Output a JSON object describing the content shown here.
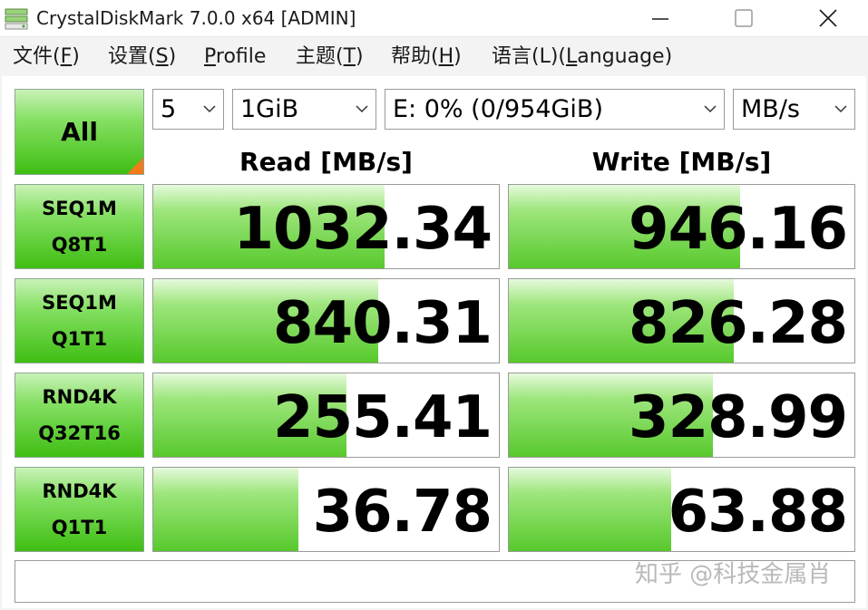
{
  "window": {
    "title": "CrystalDiskMark 7.0.0 x64 [ADMIN]"
  },
  "menu": [
    {
      "label": "文件(F)",
      "mnemonic": "F",
      "pre": "文件(",
      "post": ")"
    },
    {
      "label": "设置(S)",
      "mnemonic": "S",
      "pre": "设置(",
      "post": ")"
    },
    {
      "label": "Profile",
      "mnemonic": "P",
      "pre": "",
      "post": "rofile"
    },
    {
      "label": "主题(T)",
      "mnemonic": "T",
      "pre": "主题(",
      "post": ")"
    },
    {
      "label": "帮助(H)",
      "mnemonic": "H",
      "pre": "帮助(",
      "post": ")"
    },
    {
      "label": "语言(L)(Language)",
      "mnemonic": "L",
      "pre": "语言(L)(",
      "post": "anguage)"
    }
  ],
  "controls": {
    "all_label": "All",
    "count": "5",
    "size": "1GiB",
    "drive": "E: 0% (0/954GiB)",
    "unit": "MB/s"
  },
  "headers": {
    "read": "Read [MB/s]",
    "write": "Write [MB/s]"
  },
  "tests": [
    {
      "line1": "SEQ1M",
      "line2": "Q8T1",
      "read": "1032.34",
      "write": "946.16",
      "read_frac": 0.67,
      "write_frac": 0.67
    },
    {
      "line1": "SEQ1M",
      "line2": "Q1T1",
      "read": "840.31",
      "write": "826.28",
      "read_frac": 0.65,
      "write_frac": 0.65
    },
    {
      "line1": "RND4K",
      "line2": "Q32T16",
      "read": "255.41",
      "write": "328.99",
      "read_frac": 0.56,
      "write_frac": 0.59
    },
    {
      "line1": "RND4K",
      "line2": "Q1T1",
      "read": "36.78",
      "write": "63.88",
      "read_frac": 0.42,
      "write_frac": 0.47
    }
  ],
  "comment": "",
  "watermark": "知乎 @科技金属肖",
  "colors": {
    "bar_green": "#57c92c",
    "button_green": "#3fbe13",
    "accent_orange": "#f07a1c"
  }
}
